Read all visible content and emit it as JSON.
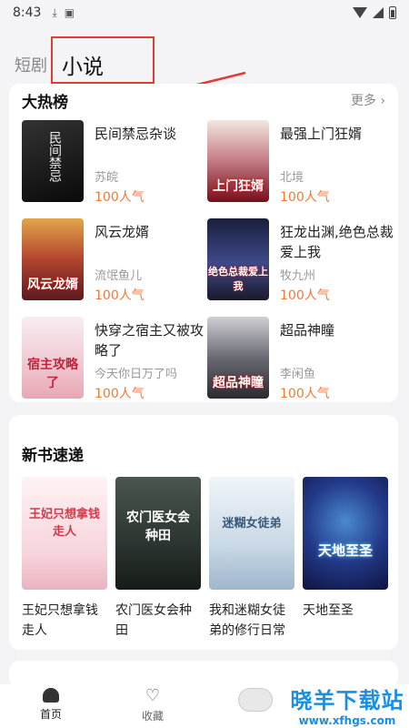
{
  "status_bar": {
    "time": "8:43",
    "download_icon": "download-arrow-icon",
    "app_icon": "a-icon"
  },
  "top_tabs": {
    "short_drama": "短剧",
    "novel": "小说"
  },
  "hot_list": {
    "title": "大热榜",
    "more": "更多",
    "books": [
      {
        "title": "民间禁忌杂谈",
        "author": "苏皖",
        "popularity": "100人气",
        "cover_text": "民间禁忌",
        "cover_color": "#1a1a1a"
      },
      {
        "title": "最强上门狂婿",
        "author": "北境",
        "popularity": "100人气",
        "cover_text": "上门狂婿",
        "cover_color": "#8a1020"
      },
      {
        "title": "风云龙婿",
        "author": "流氓鱼儿",
        "popularity": "100人气",
        "cover_text": "风云龙婿",
        "cover_color": "#b33a2a"
      },
      {
        "title": "狂龙出渊,绝色总裁爱上我",
        "author": "牧九州",
        "popularity": "100人气",
        "cover_text": "绝色总裁爱上我",
        "cover_color": "#2a2f5a"
      },
      {
        "title": "快穿之宿主又被攻略了",
        "author": "今天你日万了吗",
        "popularity": "100人气",
        "cover_text": "宿主攻略了",
        "cover_color": "#f3d6dc"
      },
      {
        "title": "超品神瞳",
        "author": "李闲鱼",
        "popularity": "100人气",
        "cover_text": "超品神瞳",
        "cover_color": "#3c3c44"
      }
    ]
  },
  "new_books": {
    "title": "新书速递",
    "books": [
      {
        "title": "王妃只想拿钱走人",
        "cover_text": "王妃只想拿钱走人",
        "cover_color": "#fbe6ea"
      },
      {
        "title": "农门医女会种田",
        "cover_text": "农门医女会种田",
        "cover_color": "#2f3a35"
      },
      {
        "title": "我和迷糊女徒弟的修行日常",
        "cover_text": "迷糊女徒弟",
        "cover_color": "#dfe9f2"
      },
      {
        "title": "天地至圣",
        "cover_text": "天地至圣",
        "cover_color": "#1d2a6a"
      }
    ]
  },
  "bottom_nav": {
    "home": "首页",
    "favorites": "收藏"
  },
  "watermark": {
    "title": "晓羊下载站",
    "url": "www.xfhgs.com"
  },
  "colors": {
    "accent_orange": "#ef7a3a",
    "annotation_red": "#e53935"
  }
}
